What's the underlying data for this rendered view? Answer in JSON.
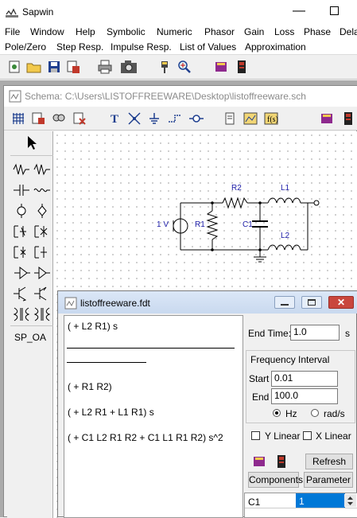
{
  "app": {
    "title": "Sapwin"
  },
  "menu": {
    "row1": [
      "File",
      "Window",
      "Help",
      "Symbolic",
      "Numeric",
      "Phasor",
      "Gain",
      "Loss",
      "Phase",
      "Dela"
    ],
    "row2": [
      "Pole/Zero",
      "Step Resp.",
      "Impulse Resp.",
      "List of Values",
      "Approximation"
    ]
  },
  "schema": {
    "title": "Schema: C:\\Users\\LISTOFFREEWARE\\Desktop\\listoffreeware.sch",
    "palette_label": "SP_OA",
    "circuit": {
      "source_label": "1 V",
      "r1": "R1",
      "r2": "R2",
      "c1": "C1",
      "l1": "L1",
      "l2": "L2"
    }
  },
  "fdt": {
    "title": "listoffreeware.fdt",
    "expr_numerator": "( + L2 R1) s",
    "expr_lines": [
      "( + R1 R2)",
      "( + L2 R1 + L1 R1) s",
      "( + C1 L2 R1 R2 + C1 L1 R1 R2) s^2"
    ],
    "end_time_label": "End Time:",
    "end_time_value": "1.0",
    "end_time_unit": "s",
    "freq_label": "Frequency Interval",
    "start_label": "Start",
    "start_value": "0.01",
    "end_label": "End",
    "end_value": "100.0",
    "hz_label": "Hz",
    "rads_label": "rad/s",
    "ylinear_label": "Y Linear",
    "xlinear_label": "X Linear",
    "refresh_label": "Refresh",
    "components_label": "Components",
    "parameter_label": "Parameter",
    "param_name": "C1",
    "param_value": "1",
    "close_glyph": "✕"
  },
  "colors": {
    "selection": "#0078d7",
    "wire": "#000000",
    "label": "#1a1aa6"
  }
}
